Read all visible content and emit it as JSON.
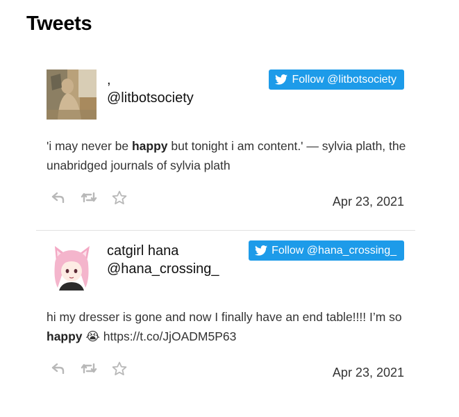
{
  "page": {
    "title": "Tweets"
  },
  "colors": {
    "follow_button": "#1d9be9",
    "icon_gray": "#b8b8b8"
  },
  "icons": {
    "follow": "twitter-bird-icon",
    "reply": "reply-icon",
    "retweet": "retweet-icon",
    "like": "star-icon"
  },
  "tweets": [
    {
      "author_name": ",",
      "handle": "@litbotsociety",
      "follow_label": "Follow @litbotsociety",
      "text_before": "'i may never be ",
      "highlight": "happy",
      "text_after": " but tonight i am content.' — sylvia plath, the unabridged journals of sylvia plath",
      "date": "Apr 23, 2021"
    },
    {
      "author_name": "catgirl hana",
      "handle": "@hana_crossing_",
      "follow_label": "Follow @hana_crossing_",
      "text_before": "hi my dresser is gone and now I finally have an end table!!!! I’m so ",
      "highlight": "happy",
      "emoji": "😭",
      "link": "https://t.co/JjOADM5P63",
      "date": "Apr 23, 2021"
    }
  ]
}
